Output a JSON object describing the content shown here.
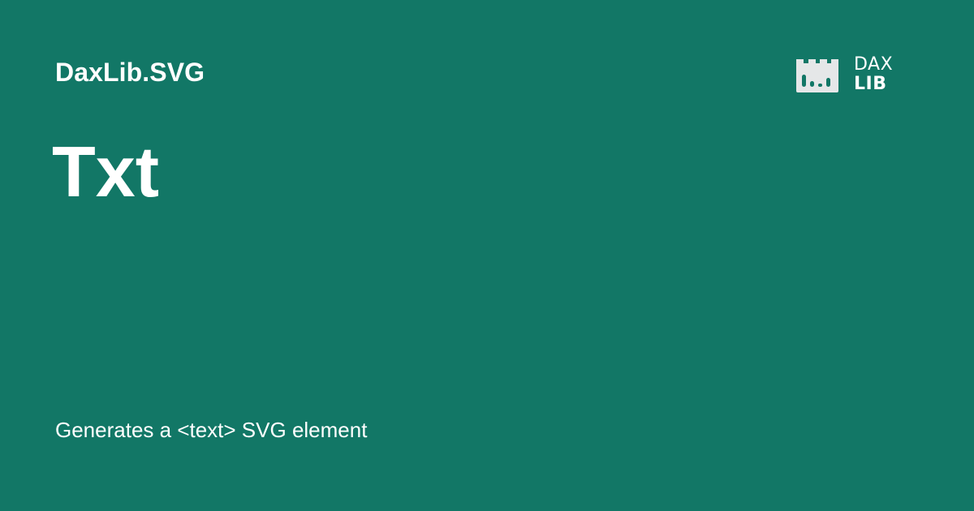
{
  "header": {
    "package_name": "DaxLib.SVG"
  },
  "main": {
    "function_name": "Txt",
    "description": "Generates a <text> SVG element"
  },
  "logo": {
    "icon": "daxlib-bar-chart-icon",
    "word_top": "DAX",
    "word_bottom": "LIB"
  },
  "colors": {
    "background": "#127766",
    "text": "#ffffff",
    "logo_panel": "#e5e7e8",
    "logo_bars": "#127766"
  }
}
